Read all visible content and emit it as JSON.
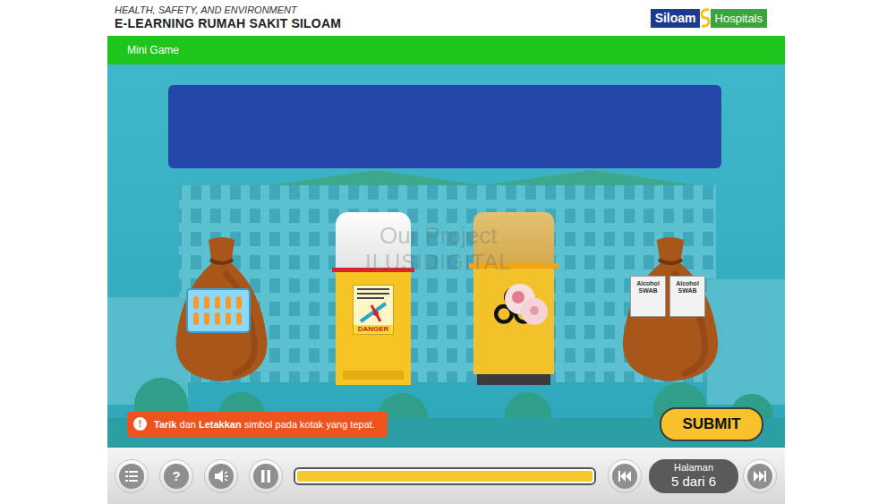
{
  "header": {
    "category": "HEALTH, SAFETY, AND ENVIRONMENT",
    "title": "E-LEARNING RUMAH SAKIT SILOAM",
    "logo": {
      "brand": "Siloam",
      "suffix": "Hospitals"
    }
  },
  "section": {
    "title": "Mini Game"
  },
  "watermark": {
    "line1": "Our Project",
    "line2": "ILUSIDIGITAL"
  },
  "bins": [
    {
      "kind": "bag",
      "item": {
        "kind": "pills"
      }
    },
    {
      "kind": "sharps",
      "label": "DANGER"
    },
    {
      "kind": "clinical",
      "item": {
        "kind": "cotton"
      }
    },
    {
      "kind": "bag",
      "item": {
        "kind": "swab",
        "labels": [
          "Alcohol SWAB",
          "Alcohol SWAB"
        ]
      }
    }
  ],
  "instruction": {
    "icon": "!",
    "parts": [
      {
        "text": "Tarik",
        "bold": true
      },
      {
        "text": " dan ",
        "bold": false
      },
      {
        "text": "Letakkan",
        "bold": true
      },
      {
        "text": " simbol pada kotak yang tepat.",
        "bold": false
      }
    ]
  },
  "submit": {
    "label": "SUBMIT"
  },
  "player": {
    "help": "?",
    "playing": true,
    "progress": {
      "level": 1
    },
    "page": {
      "label": "Halaman",
      "value": "5 dari 6"
    }
  }
}
